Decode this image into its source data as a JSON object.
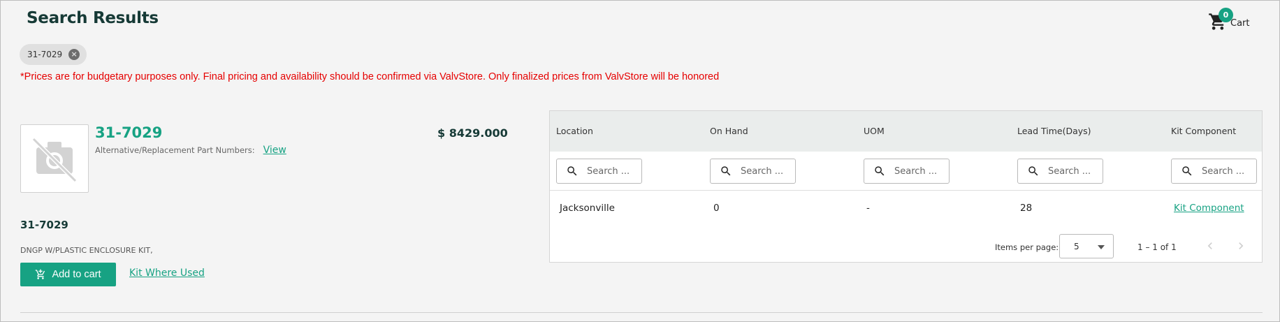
{
  "header": {
    "title": "Search Results"
  },
  "cart": {
    "count": "0",
    "label": "Cart"
  },
  "filter_chip": {
    "label": "31-7029"
  },
  "disclaimer": "*Prices are for budgetary purposes only. Final pricing and availability should be confirmed via ValvStore. Only finalized prices from ValvStore will be honored",
  "product": {
    "part_number": "31-7029",
    "alt_label": "Alternative/Replacement Part Numbers:",
    "alt_link": "View",
    "price": "$ 8429.000",
    "part_number_sub": "31-7029",
    "description": "DNGP W/PLASTIC ENCLOSURE KIT,",
    "add_to_cart": "Add to cart",
    "kit_where_used": "Kit Where Used"
  },
  "inventory_table": {
    "columns": [
      "Location",
      "On Hand",
      "UOM",
      "Lead Time(Days)",
      "Kit Component"
    ],
    "search_placeholder": "Search ...",
    "rows": [
      {
        "location": "Jacksonville",
        "on_hand": "0",
        "uom": "-",
        "lead_time": "28",
        "kit_component": "Kit Component"
      }
    ],
    "paginator": {
      "items_per_page_label": "Items per page:",
      "items_per_page": "5",
      "range": "1 – 1 of 1"
    }
  },
  "colors": {
    "accent": "#17a283",
    "title": "#163a36",
    "disclaimer": "#e60000"
  }
}
